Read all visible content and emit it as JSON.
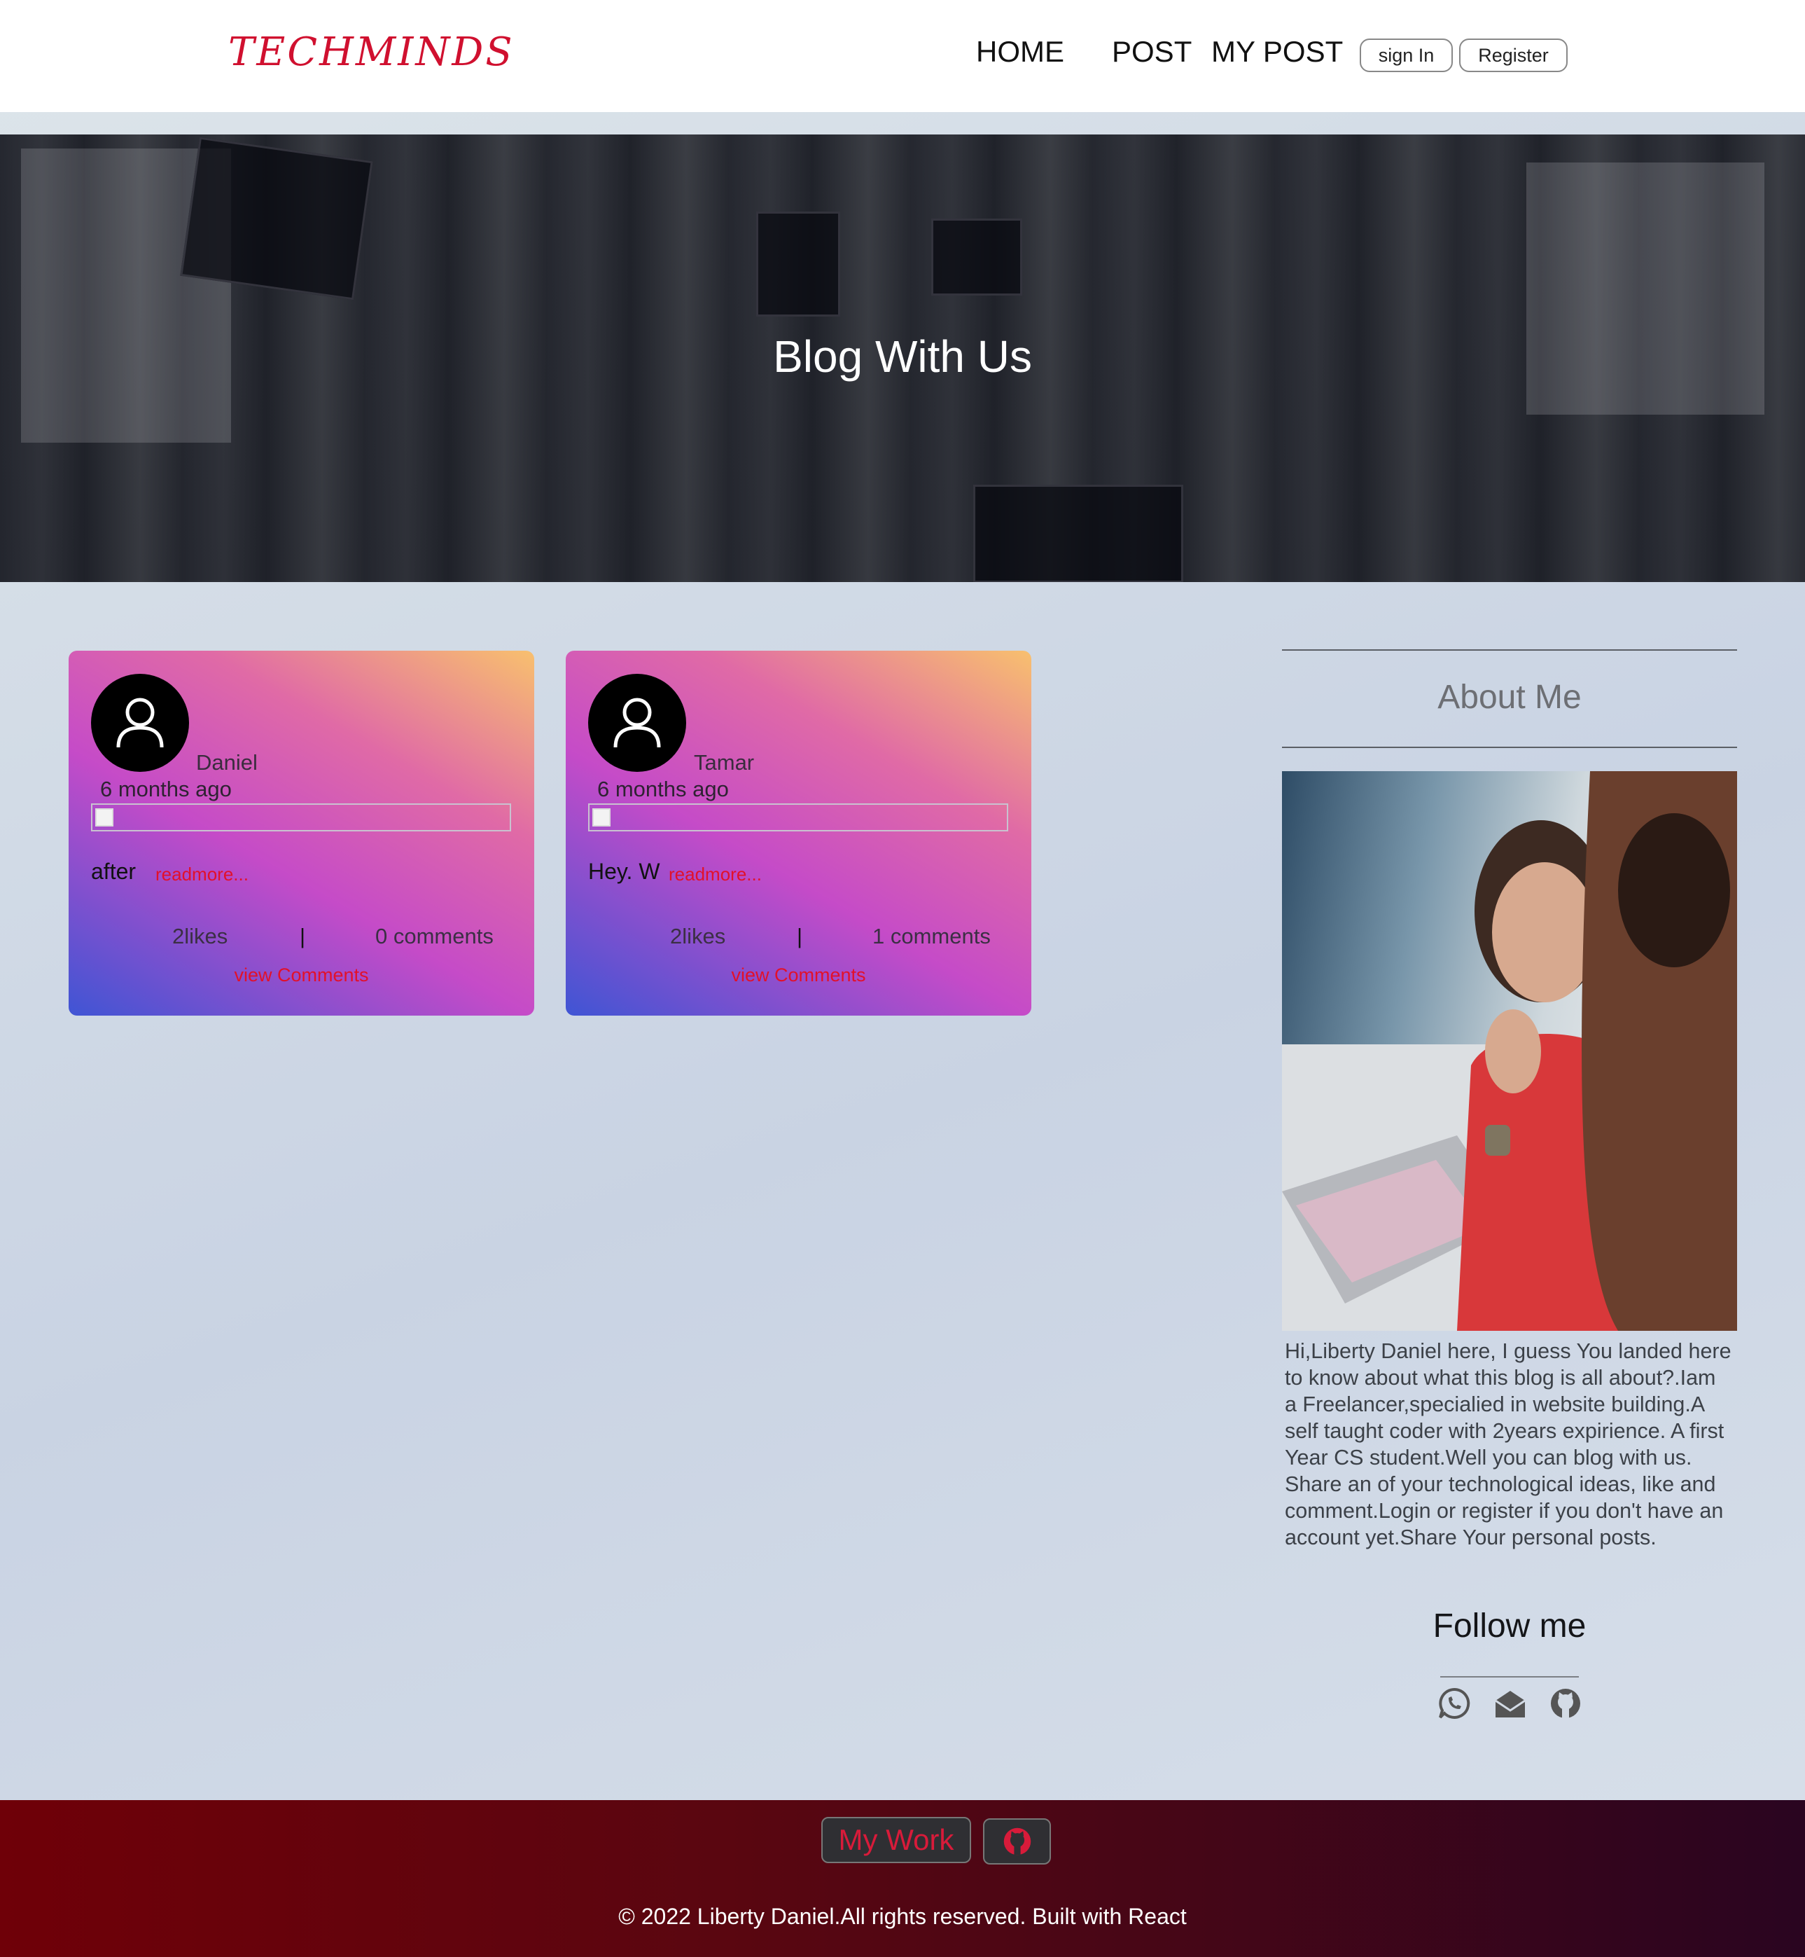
{
  "header": {
    "logo": "TECHMINDS",
    "nav": {
      "home": "HOME",
      "post": "POST",
      "my_post": "MY POST"
    },
    "sign_in": "sign In",
    "register": "Register"
  },
  "hero": {
    "title": "Blog With Us"
  },
  "posts": [
    {
      "author": "Daniel",
      "time": "6 months ago",
      "excerpt": "after",
      "readmore": "readmore...",
      "likes": "2likes",
      "separator": "|",
      "comments": "0 comments",
      "view_comments": "view Comments"
    },
    {
      "author": "Tamar",
      "time": "6 months ago",
      "excerpt": "Hey. W",
      "readmore": "readmore...",
      "likes": "2likes",
      "separator": "|",
      "comments": "1 comments",
      "view_comments": "view Comments"
    }
  ],
  "sidebar": {
    "about_title": "About Me",
    "about_text": "Hi,Liberty Daniel here, I guess You landed here to know about what this blog is all about?.Iam a Freelancer,specialied in website building.A self taught coder with 2years expirience. A first Year CS student.Well you can blog with us. Share an of your technological ideas, like and comment.Login or register if you don't have an account yet.Share Your personal posts.",
    "follow_title": "Follow me",
    "social_icons": [
      "whatsapp-icon",
      "envelope-open-icon",
      "github-icon"
    ]
  },
  "footer": {
    "my_work": "My Work",
    "copyright": "© 2022 Liberty Daniel.All rights reserved. Built with React"
  },
  "colors": {
    "brand": "#d0102f",
    "link": "#e2102a",
    "footer_start": "#6f0008",
    "footer_end": "#2a0520"
  }
}
